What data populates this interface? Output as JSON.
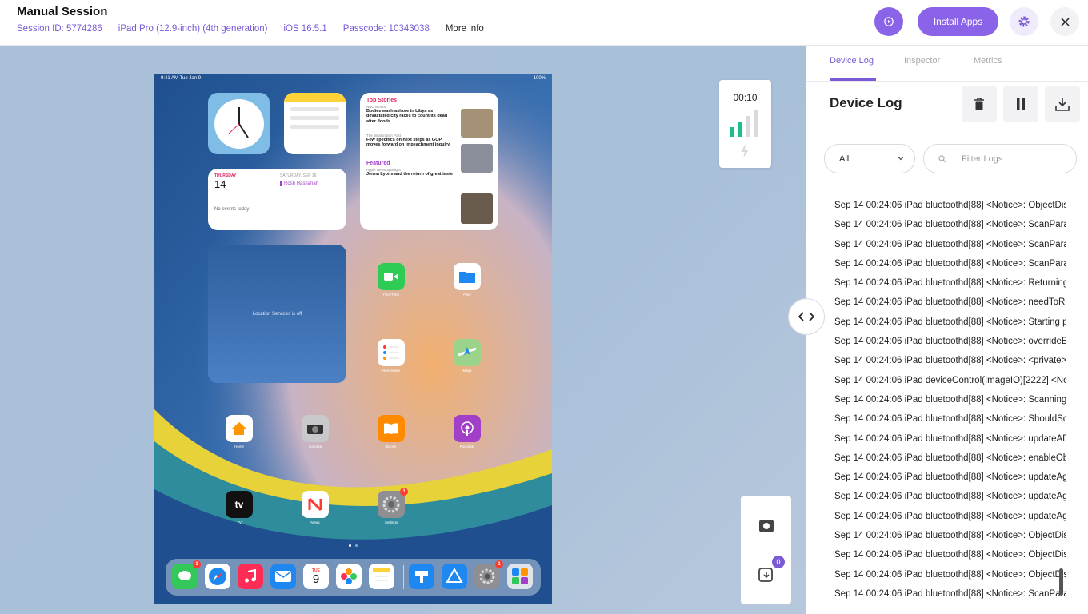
{
  "header": {
    "title": "Manual Session",
    "session_id": "Session ID: 5774286",
    "device": "iPad Pro (12.9-inch) (4th generation)",
    "os": "iOS 16.5.1",
    "passcode": "Passcode: 10343038",
    "more_info": "More info",
    "install_label": "Install Apps"
  },
  "colors": {
    "accent": "#8b63e8",
    "badge": "#ff3b30"
  },
  "ipad": {
    "status_time": "9:41 AM   Tue Jan 9",
    "status_right": "100%",
    "news": {
      "heading": "Top Stories",
      "source1": "NBC NEWS",
      "headline1": "Bodies wash ashore in Libya as devastated city races to count its dead after floods",
      "source2": "The Washington Post",
      "headline2": "Few specifics on next steps as GOP moves forward on impeachment inquiry",
      "featured": "Featured",
      "source3": "Apple News Spotlight",
      "headline3": "Jenna Lyons and the return of great taste"
    },
    "calendar": {
      "weekday": "THURSDAY",
      "day": "14",
      "sat": "SATURDAY, SEP 16",
      "event": "Rosh Hashanah",
      "none": "No events today"
    },
    "location_text": "Location Services is off",
    "apps": [
      {
        "label": "FaceTime"
      },
      {
        "label": "Files"
      },
      {
        "label": "Reminders"
      },
      {
        "label": "Maps"
      },
      {
        "label": "Home"
      },
      {
        "label": "Camera"
      },
      {
        "label": "Books"
      },
      {
        "label": "Podcasts"
      },
      {
        "label": "TV"
      },
      {
        "label": "News"
      },
      {
        "label": "Settings"
      }
    ],
    "tv_text": "tv",
    "cal_icon_day": "TUE",
    "cal_icon_num": "9",
    "settings_badge": "1",
    "messages_badge": "1",
    "dock_settings_badge": "1"
  },
  "timer": {
    "value": "00:10"
  },
  "tools": {
    "count": "0"
  },
  "panel": {
    "tabs": [
      "Device Log",
      "Inspector",
      "Metrics"
    ],
    "title": "Device Log",
    "filter_value": "All",
    "search_placeholder": "Filter Logs",
    "logs": [
      "Sep 14 00:24:06 iPad bluetoothd[88] <Notice>: ObjectDis",
      "Sep 14 00:24:06 iPad bluetoothd[88] <Notice>: ScanPara",
      "Sep 14 00:24:06 iPad bluetoothd[88] <Notice>: ScanPara",
      "Sep 14 00:24:06 iPad bluetoothd[88] <Notice>: ScanPara",
      "Sep 14 00:24:06 iPad bluetoothd[88] <Notice>: Returning",
      "Sep 14 00:24:06 iPad bluetoothd[88] <Notice>: needToRe",
      "Sep 14 00:24:06 iPad bluetoothd[88] <Notice>: Starting p",
      "Sep 14 00:24:06 iPad bluetoothd[88] <Notice>: overrideEr",
      "Sep 14 00:24:06 iPad bluetoothd[88] <Notice>: <private>",
      "Sep 14 00:24:06 iPad deviceControl(ImageIO)[2222] <No",
      "Sep 14 00:24:06 iPad bluetoothd[88] <Notice>: Scanning",
      "Sep 14 00:24:06 iPad bluetoothd[88] <Notice>: ShouldSca",
      "Sep 14 00:24:06 iPad bluetoothd[88] <Notice>: updateAD",
      "Sep 14 00:24:06 iPad bluetoothd[88] <Notice>: enableOb",
      "Sep 14 00:24:06 iPad bluetoothd[88] <Notice>: updateAg",
      "Sep 14 00:24:06 iPad bluetoothd[88] <Notice>: updateAg",
      "Sep 14 00:24:06 iPad bluetoothd[88] <Notice>: updateAg",
      "Sep 14 00:24:06 iPad bluetoothd[88] <Notice>: ObjectDis",
      "Sep 14 00:24:06 iPad bluetoothd[88] <Notice>: ObjectDis",
      "Sep 14 00:24:06 iPad bluetoothd[88] <Notice>: ObjectDis",
      "Sep 14 00:24:06 iPad bluetoothd[88] <Notice>: ScanPara"
    ]
  }
}
